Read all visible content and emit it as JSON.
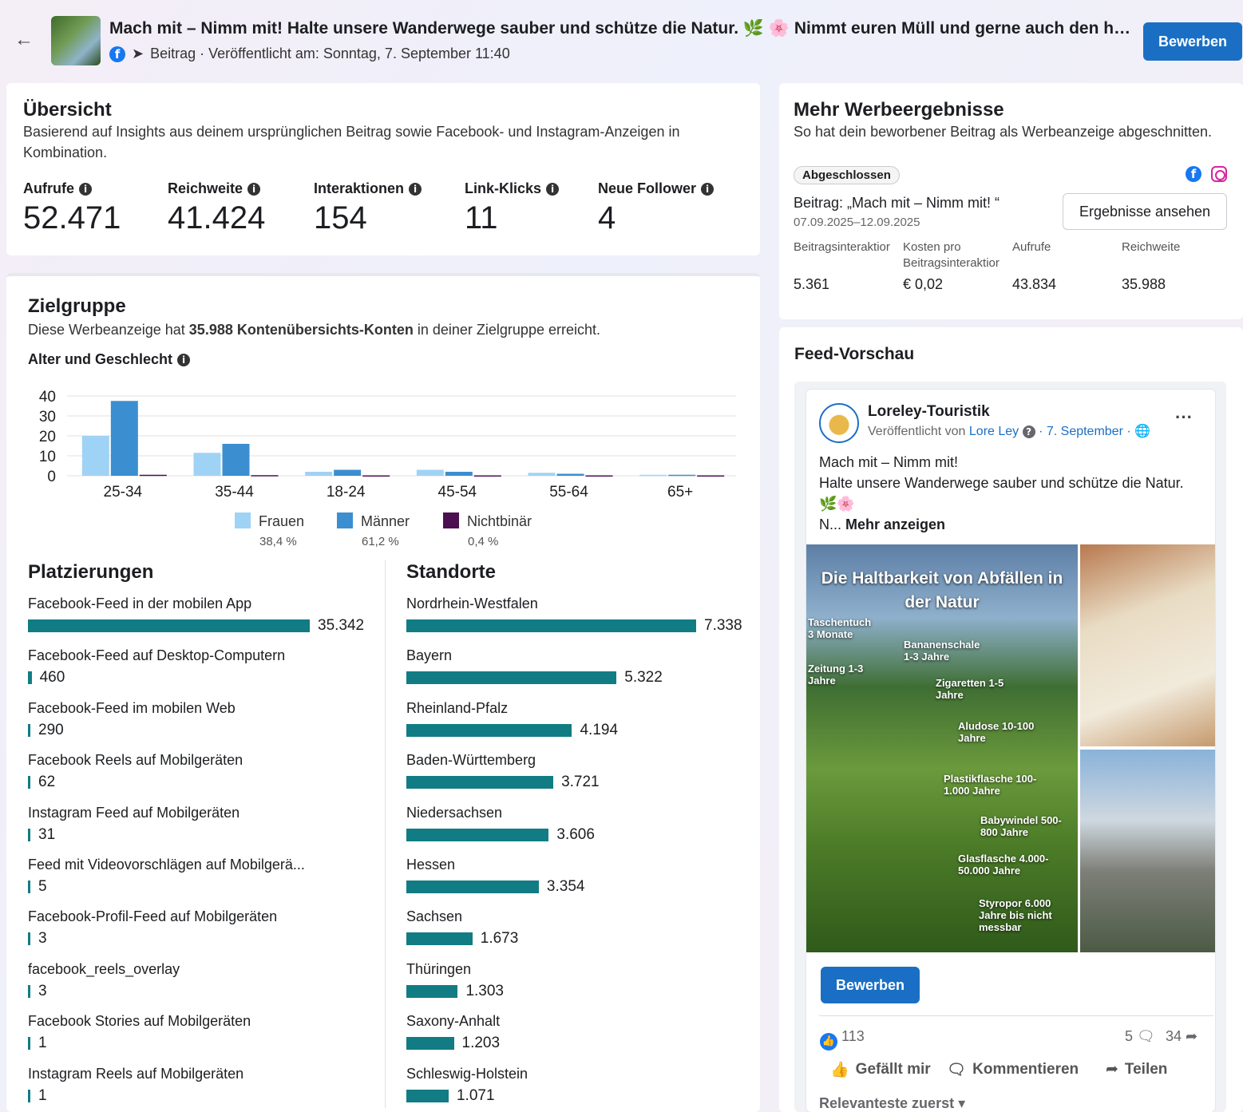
{
  "header": {
    "title": "Mach mit – Nimm mit! Halte unsere Wanderwege sauber und schütze die Natur. 🌿 🌸 Nimmt euren Müll und gerne auch den herumlie...",
    "meta": "Beitrag · Veröffentlicht am: Sonntag, 7. September 11:40",
    "boost_label": "Bewerben"
  },
  "overview": {
    "title": "Übersicht",
    "subtitle": "Basierend auf Insights aus deinem ursprünglichen Beitrag sowie Facebook- und Instagram-Anzeigen in Kombination.",
    "metrics": [
      {
        "label": "Aufrufe",
        "value": "52.471"
      },
      {
        "label": "Reichweite",
        "value": "41.424"
      },
      {
        "label": "Interaktionen",
        "value": "154"
      },
      {
        "label": "Link-Klicks",
        "value": "11"
      },
      {
        "label": "Neue Follower",
        "value": "4"
      }
    ]
  },
  "more_results": {
    "title": "Mehr Werbeergebnisse",
    "subtitle": "So hat dein beworbener Beitrag als Werbeanzeige abgeschnitten.",
    "status": "Abgeschlossen",
    "post_label": "Beitrag: „Mach mit – Nimm mit! “",
    "date_range": "07.09.2025–12.09.2025",
    "button": "Ergebnisse ansehen",
    "columns": [
      {
        "label": "Beitragsinteraktior",
        "value": "5.361"
      },
      {
        "label": "Kosten pro Beitragsinteraktior",
        "value": "€ 0,02"
      },
      {
        "label": "Aufrufe",
        "value": "43.834"
      },
      {
        "label": "Reichweite",
        "value": "35.988"
      }
    ]
  },
  "audience": {
    "title": "Zielgruppe",
    "subtitle_pre": "Diese Werbeanzeige hat ",
    "subtitle_bold": "35.988 Kontenübersichts-Konten",
    "subtitle_post": " in deiner Zielgruppe erreicht.",
    "age_gender_label": "Alter und Geschlecht",
    "legend": [
      {
        "name": "Frauen",
        "pct": "38,4 %",
        "color": "#9fd3f5"
      },
      {
        "name": "Männer",
        "pct": "61,2 %",
        "color": "#3b8fd0"
      },
      {
        "name": "Nichtbinär",
        "pct": "0,4 %",
        "color": "#4a1050"
      }
    ]
  },
  "chart_data": {
    "type": "bar",
    "categories": [
      "25-34",
      "35-44",
      "18-24",
      "45-54",
      "55-64",
      "65+"
    ],
    "series": [
      {
        "name": "Frauen",
        "values": [
          20,
          11.5,
          2,
          3,
          1.5,
          0.5
        ]
      },
      {
        "name": "Männer",
        "values": [
          37.5,
          16,
          3,
          2,
          1,
          0.5
        ]
      },
      {
        "name": "Nichtbinär",
        "values": [
          0.5,
          0.3,
          0.2,
          0.2,
          0.2,
          0.2
        ]
      }
    ],
    "yticks": [
      "40",
      "30",
      "20",
      "10",
      "0"
    ],
    "ylim": [
      0,
      40
    ],
    "grid": true,
    "colors": [
      "#9fd3f5",
      "#3b8fd0",
      "#4a1050"
    ]
  },
  "placements": {
    "title": "Platzierungen",
    "max": 35342,
    "items": [
      {
        "label": "Facebook-Feed in der mobilen App",
        "value": "35.342",
        "num": 35342
      },
      {
        "label": "Facebook-Feed auf Desktop-Computern",
        "value": "460",
        "num": 460
      },
      {
        "label": "Facebook-Feed im mobilen Web",
        "value": "290",
        "num": 290
      },
      {
        "label": "Facebook Reels auf Mobilgeräten",
        "value": "62",
        "num": 62
      },
      {
        "label": "Instagram Feed auf Mobilgeräten",
        "value": "31",
        "num": 31
      },
      {
        "label": "Feed mit Videovorschlägen auf Mobilgerä...",
        "value": "5",
        "num": 5
      },
      {
        "label": "Facebook-Profil-Feed auf Mobilgeräten",
        "value": "3",
        "num": 3
      },
      {
        "label": "facebook_reels_overlay",
        "value": "3",
        "num": 3
      },
      {
        "label": "Facebook Stories auf Mobilgeräten",
        "value": "1",
        "num": 1
      },
      {
        "label": "Instagram Reels auf Mobilgeräten",
        "value": "1",
        "num": 1
      }
    ]
  },
  "locations": {
    "title": "Standorte",
    "max": 7338,
    "items": [
      {
        "label": "Nordrhein-Westfalen",
        "value": "7.338",
        "num": 7338
      },
      {
        "label": "Bayern",
        "value": "5.322",
        "num": 5322
      },
      {
        "label": "Rheinland-Pfalz",
        "value": "4.194",
        "num": 4194
      },
      {
        "label": "Baden-Württemberg",
        "value": "3.721",
        "num": 3721
      },
      {
        "label": "Niedersachsen",
        "value": "3.606",
        "num": 3606
      },
      {
        "label": "Hessen",
        "value": "3.354",
        "num": 3354
      },
      {
        "label": "Sachsen",
        "value": "1.673",
        "num": 1673
      },
      {
        "label": "Thüringen",
        "value": "1.303",
        "num": 1303
      },
      {
        "label": "Saxony-Anhalt",
        "value": "1.203",
        "num": 1203
      },
      {
        "label": "Schleswig-Holstein",
        "value": "1.071",
        "num": 1071
      }
    ]
  },
  "feed": {
    "title": "Feed-Vorschau",
    "page_name": "Loreley-Touristik",
    "published_by_pre": "Veröffentlicht von ",
    "published_by_name": "Lore Ley",
    "published_date": "· 7. September ·",
    "text_line1": "Mach mit – Nimm mit!",
    "text_line2": "Halte unsere Wanderwege sauber und schütze die Natur. 🌿🌸",
    "text_more_pre": "N... ",
    "text_more_link": "Mehr anzeigen",
    "image_overlay": {
      "title": "Die Haltbarkeit von Abfällen in der Natur",
      "items": [
        "Taschentuch 3 Monate",
        "Zeitung 1-3 Jahre",
        "Bananenschale 1-3 Jahre",
        "Zigaretten 1-5 Jahre",
        "Aludose 10-100 Jahre",
        "Plastikflasche 100-1.000 Jahre",
        "Babywindel 500-800 Jahre",
        "Glasflasche 4.000-50.000 Jahre",
        "Styropor 6.000 Jahre bis nicht messbar"
      ]
    },
    "boost_label": "Bewerben",
    "likes": "113",
    "comments": "5",
    "shares": "34",
    "action_like": "Gefällt mir",
    "action_comment": "Kommentieren",
    "action_share": "Teilen",
    "sort": "Relevanteste zuerst"
  }
}
